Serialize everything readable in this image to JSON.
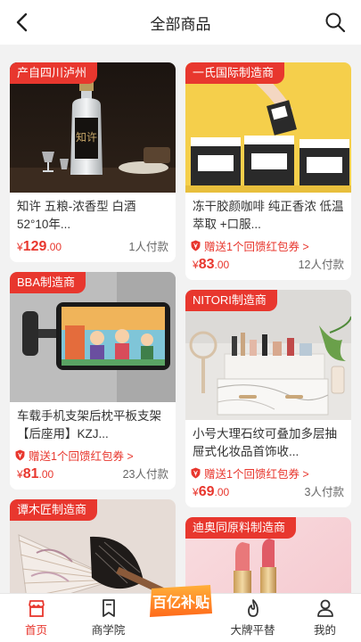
{
  "header": {
    "title": "全部商品"
  },
  "products": {
    "p1": {
      "tag": "产自四川泸州",
      "name": "知许 五粮-浓香型 白酒 52°10年...",
      "currency": "¥",
      "price_int": "129",
      "price_dec": ".00",
      "sold": "1人付款"
    },
    "p2": {
      "tag": "一氏国际制造商",
      "name": "冻干胶颜咖啡 纯正香浓 低温萃取 +口服...",
      "coupon": "赠送1个回馈红包券 >",
      "currency": "¥",
      "price_int": "83",
      "price_dec": ".00",
      "sold": "12人付款"
    },
    "p3": {
      "tag": "BBA制造商",
      "name": "车载手机支架后枕平板支架【后座用】KZJ...",
      "coupon": "赠送1个回馈红包券 >",
      "currency": "¥",
      "price_int": "81",
      "price_dec": ".00",
      "sold": "23人付款"
    },
    "p4": {
      "tag": "NITORI制造商",
      "name": "小号大理石纹可叠加多层抽屉式化妆品首饰收...",
      "coupon": "赠送1个回馈红包券 >",
      "currency": "¥",
      "price_int": "69",
      "price_dec": ".00",
      "sold": "3人付款"
    },
    "p5": {
      "tag": "谭木匠制造商"
    },
    "p6": {
      "tag": "迪奥同原料制造商"
    }
  },
  "bottle_label": "知许",
  "tabs": {
    "home": "首页",
    "academy": "商学院",
    "center_logo": "百亿补贴",
    "brand": "大牌平替",
    "mine": "我的"
  },
  "colors": {
    "accent": "#e8372e",
    "background": "#f2f2f2"
  }
}
